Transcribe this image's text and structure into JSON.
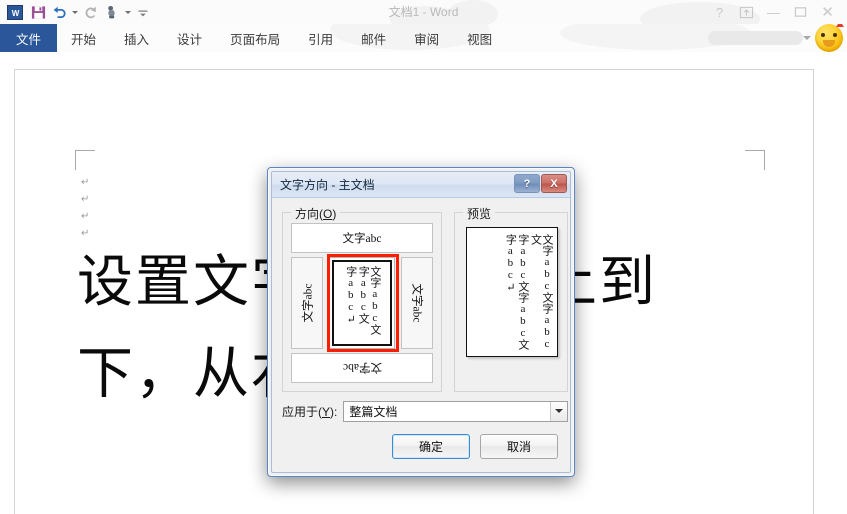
{
  "window": {
    "title": "文档1 - Word",
    "quick_access": [
      {
        "name": "word-logo-icon",
        "label": "W"
      },
      {
        "name": "save-icon",
        "label": "保存"
      },
      {
        "name": "undo-icon",
        "label": "撤消"
      },
      {
        "name": "redo-icon",
        "label": "恢复"
      },
      {
        "name": "touch-mode-icon",
        "label": "触摸/鼠标模式"
      },
      {
        "name": "customize-qat-icon",
        "label": "自定义快速访问工具栏"
      }
    ],
    "controls": {
      "help": "?",
      "ribbon_display": "▣",
      "minimize": "—",
      "restore": "❐",
      "close": "✕"
    }
  },
  "ribbon": {
    "tabs": [
      {
        "label": "文件",
        "active": true
      },
      {
        "label": "开始",
        "active": false
      },
      {
        "label": "插入",
        "active": false
      },
      {
        "label": "设计",
        "active": false
      },
      {
        "label": "页面布局",
        "active": false
      },
      {
        "label": "引用",
        "active": false
      },
      {
        "label": "邮件",
        "active": false
      },
      {
        "label": "审阅",
        "active": false
      },
      {
        "label": "视图",
        "active": false
      }
    ],
    "accent_color": "#2B579A"
  },
  "document": {
    "line1": "设置文字方向，从上到",
    "line2": "下，从右向左输入",
    "pilcrow": "↵",
    "empty_line_marks": "↵\n↵\n↵\n↵"
  },
  "dialog": {
    "title": "文字方向 - 主文档",
    "titlebar_buttons": {
      "help": "?",
      "close": "X"
    },
    "direction_group": {
      "label_text": "方向(",
      "label_accel": "O",
      "label_tail": ")",
      "options": [
        {
          "name": "horizontal",
          "label": "文字abc",
          "selected": false,
          "rotation": "0"
        },
        {
          "name": "rotate-left",
          "label": "文字abc",
          "selected": false,
          "rotation": "-90"
        },
        {
          "name": "vertical-rl",
          "label": "文字abc文字abc文",
          "selected": true,
          "rotation": "vertical"
        },
        {
          "name": "rotate-right",
          "label": "文字abc",
          "selected": false,
          "rotation": "90"
        },
        {
          "name": "upside-down",
          "label": "文字abc",
          "selected": false,
          "rotation": "180"
        }
      ],
      "selected_option": "vertical-rl",
      "highlight_color": "#ff1d00"
    },
    "preview_group": {
      "label": "预览",
      "columns": [
        "文字abc文字abc文",
        "字abc文字abc文",
        "字abc↵"
      ]
    },
    "apply_to": {
      "label_text": "应用于(",
      "label_accel": "Y",
      "label_tail": "):",
      "value": "整篇文档"
    },
    "buttons": {
      "ok": "确定",
      "cancel": "取消"
    }
  }
}
